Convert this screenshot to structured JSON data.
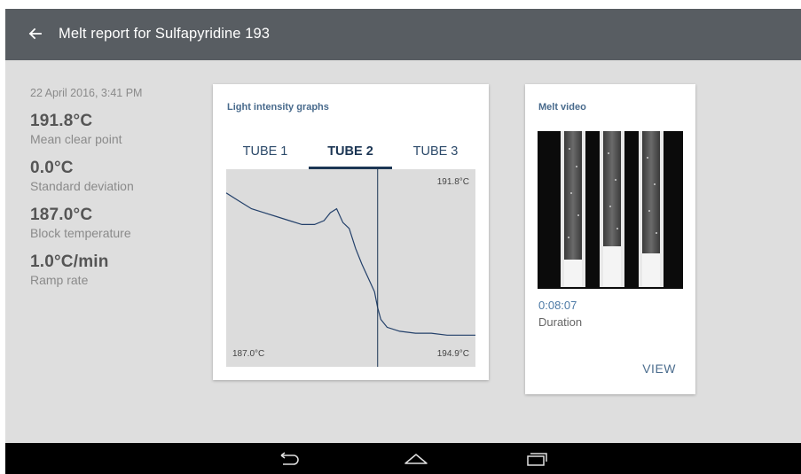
{
  "appbar": {
    "title": "Melt report for Sulfapyridine 193",
    "back_icon": "arrow-left-icon"
  },
  "meta": {
    "date": "22 April 2016, 3:41 PM",
    "stats": [
      {
        "value": "191.8°C",
        "label": "Mean clear point"
      },
      {
        "value": "0.0°C",
        "label": "Standard deviation"
      },
      {
        "value": "187.0°C",
        "label": "Block temperature"
      },
      {
        "value": "1.0°C/min",
        "label": "Ramp rate"
      }
    ]
  },
  "light_card": {
    "title": "Light intensity graphs",
    "tabs": [
      {
        "label": "TUBE 1"
      },
      {
        "label": "TUBE 2",
        "active": true
      },
      {
        "label": "TUBE 3"
      }
    ],
    "graph": {
      "start_label": "187.0°C",
      "end_label": "194.9°C",
      "marker_label": "191.8°C"
    }
  },
  "video_card": {
    "title": "Melt video",
    "duration": "0:08:07",
    "duration_label": "Duration",
    "view_label": "VIEW"
  },
  "navbar": {
    "icons": [
      "back-nav-icon",
      "home-nav-icon",
      "recents-nav-icon"
    ]
  },
  "colors": {
    "appbar": "#585d62",
    "background": "#dedede",
    "accent": "#1c3654",
    "graph_line": "#23406a"
  },
  "chart_data": {
    "type": "line",
    "title": "",
    "xlabel": "",
    "ylabel": "",
    "x_range": [
      187.0,
      194.9
    ],
    "marker_x": 191.8,
    "series": [
      {
        "x": [
          187.0,
          187.4,
          187.8,
          188.2,
          188.6,
          189.0,
          189.4,
          189.8,
          190.1,
          190.3,
          190.5,
          190.7,
          190.9,
          191.1,
          191.3,
          191.5,
          191.7,
          191.8,
          191.9,
          192.1,
          192.5,
          193.0,
          193.5,
          194.0,
          194.5,
          194.9
        ],
        "y": [
          0.88,
          0.84,
          0.8,
          0.78,
          0.76,
          0.74,
          0.72,
          0.72,
          0.74,
          0.78,
          0.8,
          0.73,
          0.7,
          0.6,
          0.52,
          0.45,
          0.38,
          0.3,
          0.24,
          0.2,
          0.18,
          0.17,
          0.17,
          0.16,
          0.16,
          0.16
        ]
      }
    ]
  }
}
